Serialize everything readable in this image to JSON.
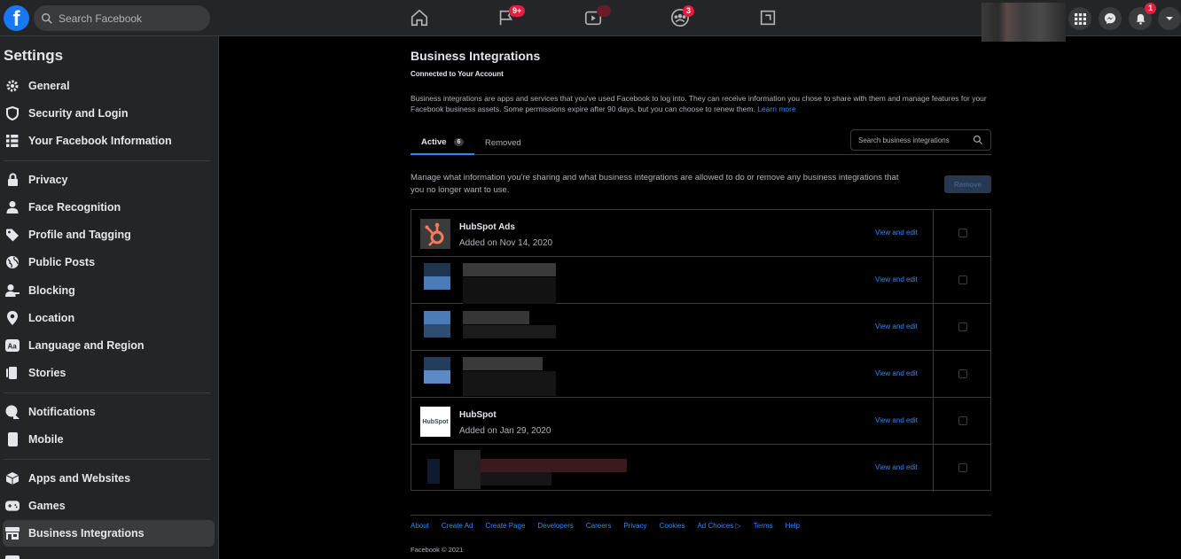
{
  "topbar": {
    "logo": "f",
    "search_placeholder": "Search Facebook",
    "pages_badge": "9+",
    "video_badge": "",
    "groups_badge": "3",
    "notifications_badge": "1"
  },
  "sidebar": {
    "title": "Settings",
    "groups": [
      [
        "General",
        "Security and Login",
        "Your Facebook Information"
      ],
      [
        "Privacy",
        "Face Recognition",
        "Profile and Tagging",
        "Public Posts",
        "Blocking",
        "Location",
        "Language and Region",
        "Stories"
      ],
      [
        "Notifications",
        "Mobile"
      ],
      [
        "Apps and Websites",
        "Games",
        "Business Integrations"
      ]
    ],
    "active": "Business Integrations"
  },
  "main": {
    "title": "Business Integrations",
    "subtitle": "Connected to Your Account",
    "description": "Business integrations are apps and services that you've used Facebook to log into. They can receive information you chose to share with them and manage features for your Facebook business assets. Some permissions expire after 90 days, but you can choose to renew them.",
    "learn_more": "Learn more",
    "tabs": {
      "active_label": "Active",
      "active_count": "6",
      "removed_label": "Removed"
    },
    "search_placeholder": "Search business integrations",
    "manage_text": "Manage what information you're sharing and what business integrations are allowed to do or remove any business integrations that you no longer want to use.",
    "remove_label": "Remove",
    "view_edit_label": "View and edit",
    "rows": [
      {
        "name": "HubSpot Ads",
        "date": "Added on Nov 14, 2020",
        "logo": "hubspot-sprocket"
      },
      {
        "name": "",
        "date": "",
        "logo": "blurred"
      },
      {
        "name": "",
        "date": "",
        "logo": "blurred"
      },
      {
        "name": "",
        "date": "",
        "logo": "blurred"
      },
      {
        "name": "HubSpot",
        "date": "Added on Jan 29, 2020",
        "logo": "hubspot-wordmark",
        "logo_text": "HubSpot"
      },
      {
        "name": "",
        "date": "",
        "logo": "blurred"
      }
    ]
  },
  "footer": {
    "links": [
      "About",
      "Create Ad",
      "Create Page",
      "Developers",
      "Careers",
      "Privacy",
      "Cookies",
      "Ad Choices",
      "Terms",
      "Help"
    ],
    "copyright": "Facebook © 2021"
  },
  "colors": {
    "accent": "#2d88ff",
    "brand": "#1877f2",
    "badge": "#e41e3f"
  }
}
